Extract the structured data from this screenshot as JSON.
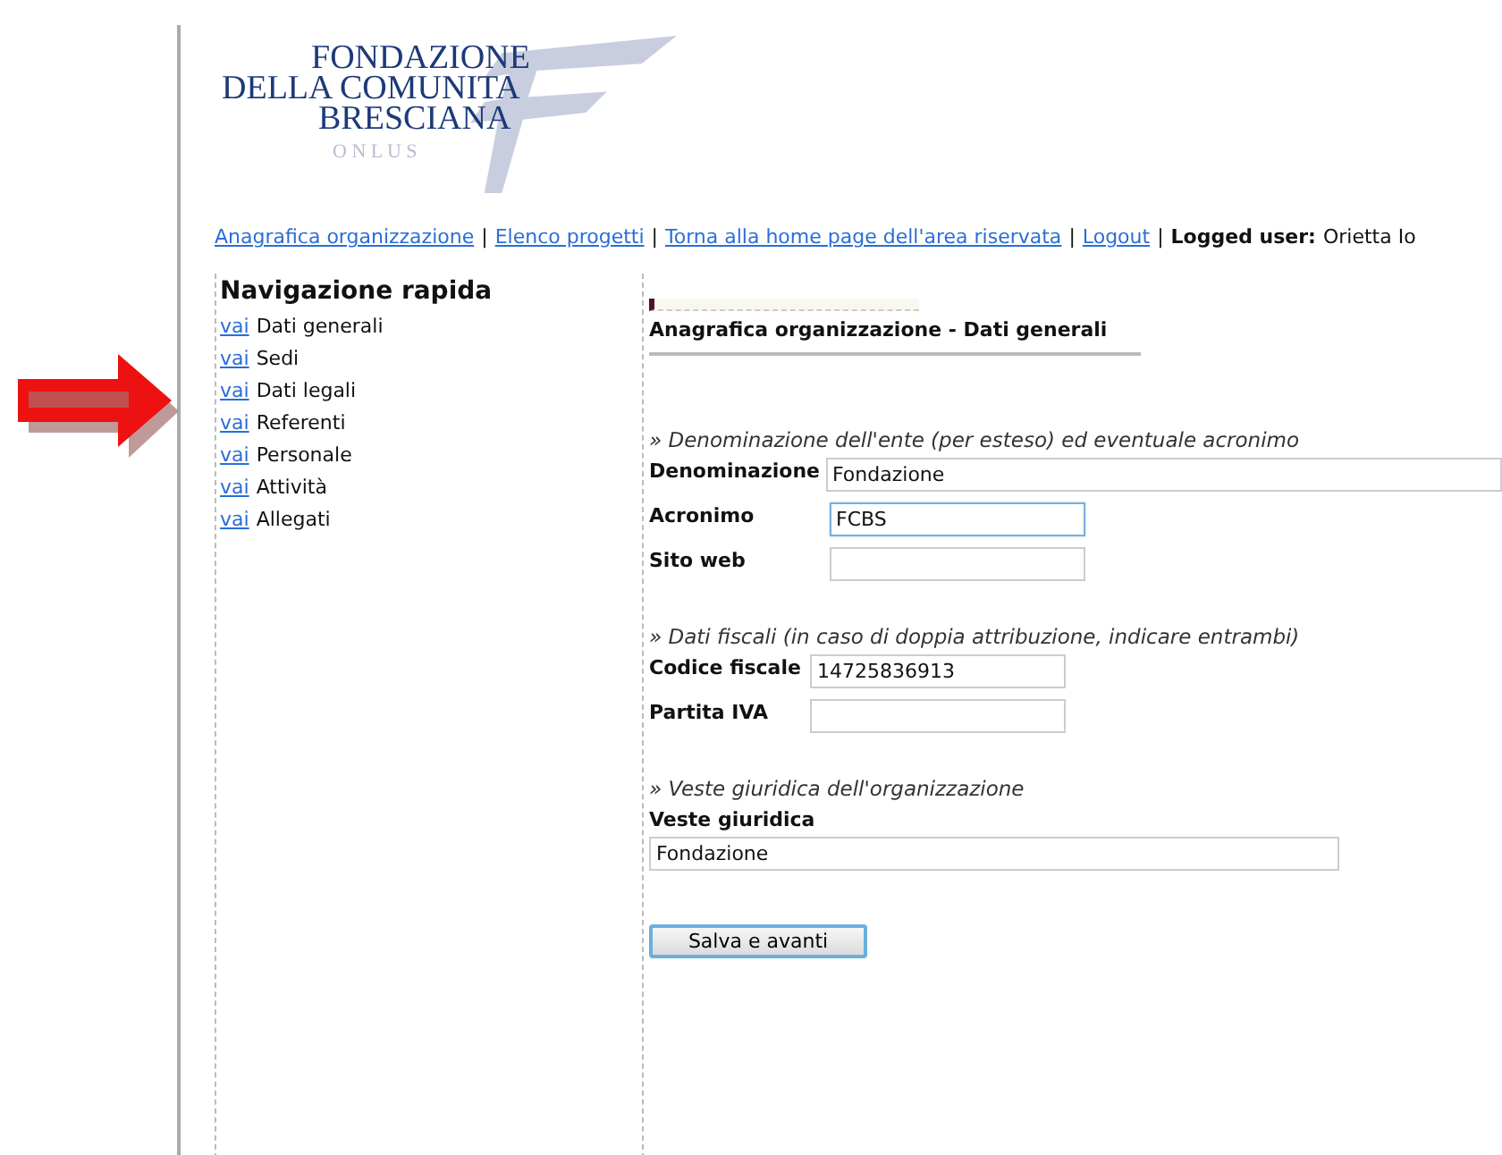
{
  "logo": {
    "lines": [
      "FONDAZIONE",
      "DELLA COMUNITA",
      "BRESCIANA"
    ],
    "tagline": "O N L U S"
  },
  "link_separator": "|",
  "top_links": [
    {
      "label": "Anagrafica organizzazione"
    },
    {
      "label": "Elenco progetti"
    },
    {
      "label": "Torna alla home page dell'area riservata"
    },
    {
      "label": "Logout"
    }
  ],
  "logged_user": {
    "label": "Logged user:",
    "value": "Orietta Io"
  },
  "sidebar": {
    "title": "Navigazione rapida",
    "items": [
      {
        "link": "vai",
        "label": "Dati generali"
      },
      {
        "link": "vai",
        "label": "Sedi"
      },
      {
        "link": "vai",
        "label": "Dati legali"
      },
      {
        "link": "vai",
        "label": "Referenti"
      },
      {
        "link": "vai",
        "label": "Personale"
      },
      {
        "link": "vai",
        "label": "Attività"
      },
      {
        "link": "vai",
        "label": "Allegati"
      }
    ]
  },
  "content": {
    "title": "Anagrafica organizzazione - Dati generali",
    "sections": [
      {
        "heading": "» Denominazione dell'ente (per esteso) ed eventuale acronimo",
        "fields": [
          {
            "label": "Denominazione",
            "value": "Fondazione",
            "kind": "wide",
            "focused": false
          },
          {
            "label": "Acronimo",
            "value": "FCBS",
            "kind": "short",
            "focused": true
          },
          {
            "label": "Sito web",
            "kind": "short",
            "focused": false
          }
        ]
      },
      {
        "heading": "» Dati fiscali (in caso di doppia attribuzione, indicare entrambi)",
        "fields": [
          {
            "label": "Codice fiscale",
            "value": "14725836913",
            "kind": "short",
            "focused": false
          },
          {
            "label": "Partita IVA",
            "kind": "short",
            "focused": false
          }
        ]
      },
      {
        "heading": "» Veste giuridica dell'organizzazione",
        "fields": [
          {
            "label": "Veste giuridica",
            "value": "Fondazione",
            "kind": "stacked",
            "focused": false
          }
        ]
      }
    ]
  },
  "submit": {
    "label": "Salva e avanti"
  }
}
